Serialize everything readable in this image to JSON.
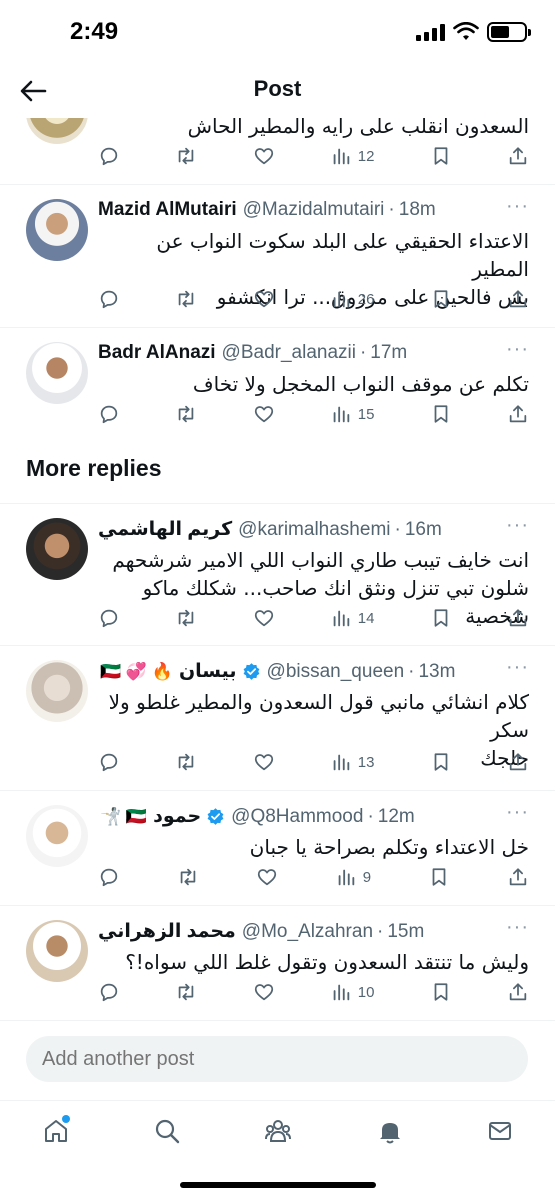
{
  "status_bar": {
    "time": "2:49"
  },
  "header": {
    "title": "Post"
  },
  "partial_post": {
    "text": "السعدون انقلب على رايه والمطير الحاش",
    "views": "12"
  },
  "posts": [
    {
      "name": "Mazid AlMutairi",
      "handle": "@Mazidalmutairi",
      "time": "18m",
      "text_line1": "الاعتداء الحقيقي على البلد سكوت النواب عن المطير",
      "text_line2": "بس فالحين على مرزوق... ترا انكشفو",
      "views": "26"
    },
    {
      "name": "Badr AlAnazi",
      "handle": "@Badr_alanazii",
      "time": "17m",
      "text_line1": "تكلم عن موقف النواب المخجل ولا تخاف",
      "views": "15"
    }
  ],
  "section": {
    "title": "More replies"
  },
  "more_replies": [
    {
      "name": "كريم الهاشمي",
      "handle": "@karimalhashemi",
      "time": "16m",
      "text_line1": "انت خايف تيبب طاري النواب اللي الامير شرشحهم",
      "text_line2": "شلون تبي تنزل ونثق انك صاحب... شكلك ماكو شخصية",
      "views": "14"
    },
    {
      "name": "بيسان",
      "emojis": "🇰🇼 💞 🔥",
      "handle": "@bissan_queen",
      "time": "13m",
      "text_line1": "كلام انشائي مانبي قول السعدون والمطير غلطو ولا سكر",
      "text_line2": "حلجك",
      "views": "13"
    },
    {
      "name": "حمود",
      "emojis": "🤺 🇰🇼",
      "handle": "@Q8Hammood",
      "time": "12m",
      "text_line1": "خل الاعتداء وتكلم بصراحة يا جبان",
      "views": "9"
    },
    {
      "name": "محمد الزهراني",
      "handle": "@Mo_Alzahran",
      "time": "15m",
      "text_line1": "وليش ما تنتقد السعدون وتقول غلط اللي سواه!؟",
      "views": "10"
    }
  ],
  "reply_box": {
    "placeholder": "Add another post"
  },
  "icons": {
    "back": "arrow-left-icon",
    "reply": "comment-icon",
    "repost": "repost-icon",
    "like": "heart-icon",
    "views": "views-icon",
    "bookmark": "bookmark-icon",
    "share": "share-icon",
    "verified": "verified-badge-icon",
    "tabs": [
      "home-icon",
      "search-icon",
      "communities-icon",
      "notifications-icon",
      "messages-icon"
    ]
  },
  "colors": {
    "accent": "#1d9bf0",
    "secondary_text": "#536471",
    "divider": "#eff3f4"
  }
}
